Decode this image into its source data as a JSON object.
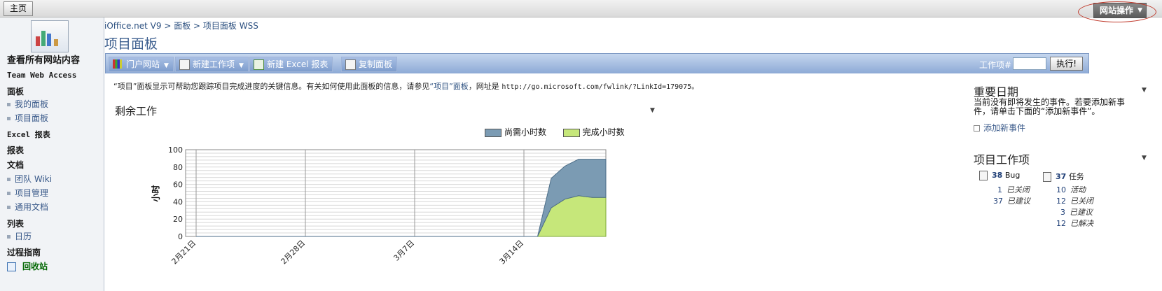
{
  "topbar": {
    "home_tab": "主页",
    "site_actions": "网站操作"
  },
  "sidebar": {
    "view_all": "查看所有网站内容",
    "team_web_access": "Team Web Access",
    "dashboards_heading": "面板",
    "dashboards": [
      "我的面板",
      "项目面板"
    ],
    "excel_reports": "Excel 报表",
    "reports_heading": "报表",
    "documents_heading": "文档",
    "documents": [
      "团队 Wiki",
      "项目管理",
      "通用文档"
    ],
    "lists_heading": "列表",
    "lists": [
      "日历"
    ],
    "process_guidance": "过程指南",
    "recycle_bin": "回收站"
  },
  "breadcrumb": "iOffice.net V9 > 面板 > 项目面板 WSS",
  "page_title": "项目面板",
  "toolbar": {
    "portal": "门户网站",
    "new_work_item": "新建工作项",
    "new_excel_report": "新建 Excel 报表",
    "copy_dashboard": "复制面板",
    "work_item_label": "工作项#",
    "execute": "执行!"
  },
  "intro": {
    "part1": "“项目”面板显示可帮助您跟踪项目完成进度的关键信息。有关如何使用此面板的信息，请参见",
    "link": "“项目”面板",
    "part2": "，网址是",
    "url": "http://go.microsoft.com/fwlink/?LinkId=179075。"
  },
  "remaining_work": {
    "title": "剩余工作",
    "ylabel": "小时"
  },
  "chart_data": {
    "type": "area",
    "x_tick_labels": [
      "2月21日",
      "2月28日",
      "3月7日",
      "3月14日"
    ],
    "x": [
      "2月21日",
      "2月28日",
      "3月7日",
      "3月14日",
      "3月15日",
      "3月16日",
      "3月17日",
      "3月18日",
      "3月19日",
      "3月20日"
    ],
    "series": [
      {
        "name": "尚需小时数",
        "color": "#7b9bb3",
        "values": [
          0,
          0,
          0,
          0,
          0,
          34,
          38,
          42,
          44,
          44
        ]
      },
      {
        "name": "完成小时数",
        "color": "#c6e77a",
        "values": [
          0,
          0,
          0,
          0,
          0,
          33,
          43,
          47,
          45,
          45
        ]
      }
    ],
    "stacked": true,
    "ylim": [
      0,
      100
    ],
    "yticks": [
      0,
      20,
      40,
      60,
      80,
      100
    ],
    "legend": "top-right",
    "grid": true
  },
  "important_dates": {
    "title": "重要日期",
    "text": "当前没有即将发生的事件。若要添加新事件，请单击下面的“添加新事件”。",
    "add": "添加新事件"
  },
  "project_work_items": {
    "title": "项目工作项",
    "bug": {
      "count": "38",
      "label": "Bug",
      "rows": [
        {
          "n": "1",
          "s": "已关闭"
        },
        {
          "n": "37",
          "s": "已建议"
        }
      ]
    },
    "task": {
      "count": "37",
      "label": "任务",
      "rows": [
        {
          "n": "10",
          "s": "活动"
        },
        {
          "n": "12",
          "s": "已关闭"
        },
        {
          "n": "3",
          "s": "已建议"
        },
        {
          "n": "12",
          "s": "已解决"
        }
      ]
    }
  }
}
